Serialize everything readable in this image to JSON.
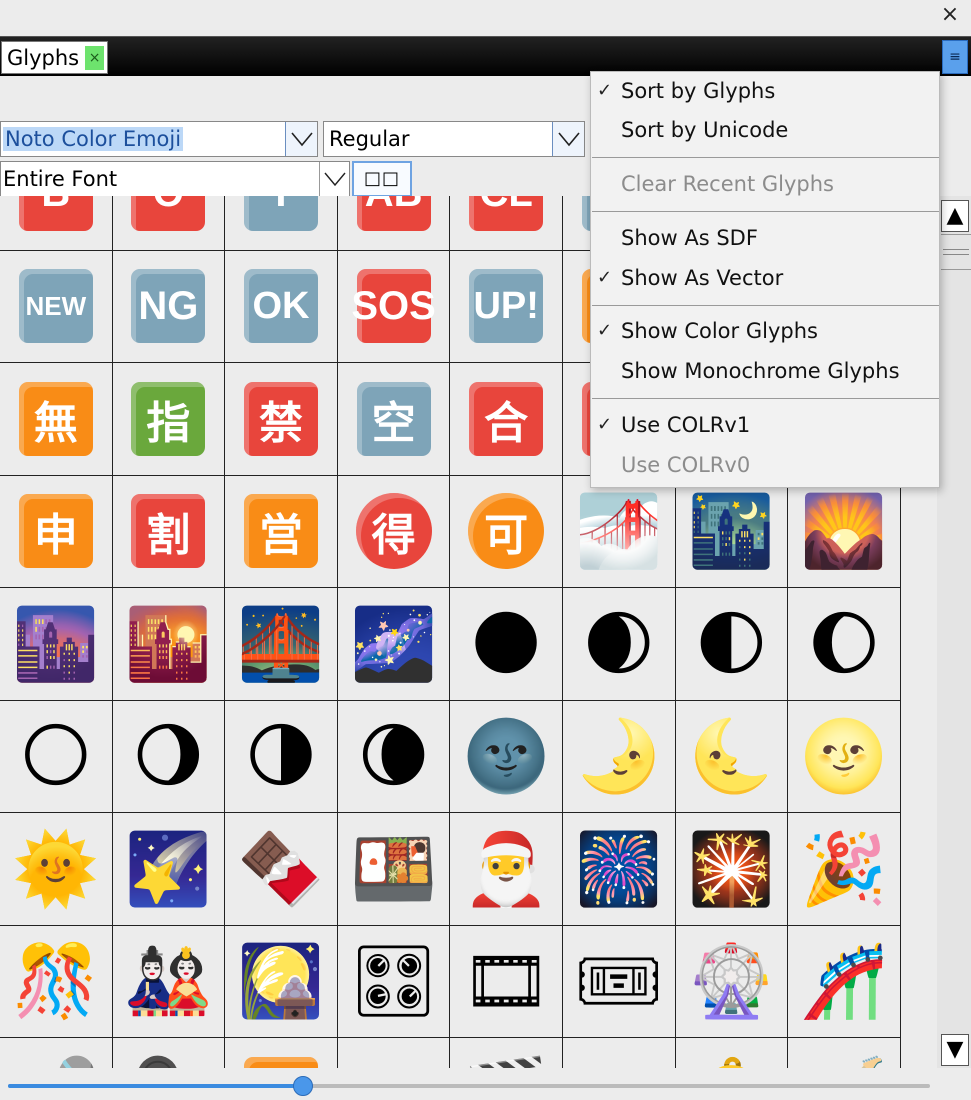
{
  "window": {
    "close_glyph": "×"
  },
  "tabs": [
    {
      "label": "Glyphs",
      "close_glyph": "×"
    }
  ],
  "menu_button_glyph": "≡",
  "toolbar": {
    "font": "Noto Color Emoji",
    "style": "Regular",
    "range": "Entire Font",
    "display_toggle": "□□"
  },
  "menu": {
    "items": [
      {
        "label": "Sort by Glyphs",
        "checked": true,
        "enabled": true
      },
      {
        "label": "Sort by Unicode",
        "checked": false,
        "enabled": true
      },
      {
        "label": "Clear Recent Glyphs",
        "checked": false,
        "enabled": false
      },
      {
        "label": "Show As SDF",
        "checked": false,
        "enabled": true
      },
      {
        "label": "Show As Vector",
        "checked": true,
        "enabled": true
      },
      {
        "label": "Show Color Glyphs",
        "checked": true,
        "enabled": true
      },
      {
        "label": "Show Monochrome Glyphs",
        "checked": false,
        "enabled": true
      },
      {
        "label": "Use COLRv1",
        "checked": true,
        "enabled": true
      },
      {
        "label": "Use COLRv0",
        "checked": false,
        "enabled": false
      }
    ],
    "check_glyph": "✓"
  },
  "scrollbar": {
    "up": "▲",
    "down": "▼"
  },
  "zoom_slider": {
    "value": 0.32
  },
  "glyphs": [
    {
      "kind": "key",
      "text": "B",
      "color": "#e8453c"
    },
    {
      "kind": "key",
      "text": "O",
      "color": "#e8453c"
    },
    {
      "kind": "key",
      "text": "I",
      "color": "#7ea4b8"
    },
    {
      "kind": "key",
      "text": "AB",
      "color": "#e8453c"
    },
    {
      "kind": "key",
      "text": "CL",
      "color": "#e8453c"
    },
    {
      "kind": "key",
      "text": "",
      "color": "#7ea4b8"
    },
    {
      "kind": "blank"
    },
    {
      "kind": "blank"
    },
    {
      "kind": "key",
      "text": "NEW",
      "color": "#7ea4b8",
      "size": "sm"
    },
    {
      "kind": "key",
      "text": "NG",
      "color": "#7ea4b8"
    },
    {
      "kind": "key",
      "text": "OK",
      "color": "#7ea4b8",
      "size": "md"
    },
    {
      "kind": "key",
      "text": "SOS",
      "color": "#e8453c"
    },
    {
      "kind": "key",
      "text": "UP!",
      "color": "#7ea4b8",
      "size": "md"
    },
    {
      "kind": "key",
      "text": "",
      "color": "#f98c16"
    },
    {
      "kind": "blank"
    },
    {
      "kind": "blank"
    },
    {
      "kind": "key",
      "text": "無",
      "color": "#f98c16",
      "size": "cjk"
    },
    {
      "kind": "key",
      "text": "指",
      "color": "#6aa83c",
      "size": "cjk"
    },
    {
      "kind": "key",
      "text": "禁",
      "color": "#e8453c",
      "size": "cjk"
    },
    {
      "kind": "key",
      "text": "空",
      "color": "#7ea4b8",
      "size": "cjk"
    },
    {
      "kind": "key",
      "text": "合",
      "color": "#e8453c",
      "size": "cjk"
    },
    {
      "kind": "key",
      "text": "",
      "color": "#e8453c"
    },
    {
      "kind": "blank"
    },
    {
      "kind": "blank"
    },
    {
      "kind": "key",
      "text": "申",
      "color": "#f98c16",
      "size": "cjk"
    },
    {
      "kind": "key",
      "text": "割",
      "color": "#e8453c",
      "size": "cjk"
    },
    {
      "kind": "key",
      "text": "営",
      "color": "#f98c16",
      "size": "cjk"
    },
    {
      "kind": "circle",
      "text": "得",
      "color": "#e8453c"
    },
    {
      "kind": "circle",
      "text": "可",
      "color": "#f98c16"
    },
    {
      "kind": "emoji",
      "text": "🌁"
    },
    {
      "kind": "emoji",
      "text": "🌃"
    },
    {
      "kind": "emoji",
      "text": "🌄"
    },
    {
      "kind": "emoji",
      "text": "🌆"
    },
    {
      "kind": "emoji",
      "text": "🌇"
    },
    {
      "kind": "emoji",
      "text": "🌉"
    },
    {
      "kind": "emoji",
      "text": "🌌"
    },
    {
      "kind": "emoji",
      "text": "🌑"
    },
    {
      "kind": "emoji",
      "text": "🌒"
    },
    {
      "kind": "emoji",
      "text": "🌓"
    },
    {
      "kind": "emoji",
      "text": "🌔"
    },
    {
      "kind": "emoji",
      "text": "🌕"
    },
    {
      "kind": "emoji",
      "text": "🌖"
    },
    {
      "kind": "emoji",
      "text": "🌗"
    },
    {
      "kind": "emoji",
      "text": "🌘"
    },
    {
      "kind": "emoji",
      "text": "🌚"
    },
    {
      "kind": "emoji",
      "text": "🌛"
    },
    {
      "kind": "emoji",
      "text": "🌜"
    },
    {
      "kind": "emoji",
      "text": "🌝"
    },
    {
      "kind": "emoji",
      "text": "🌞"
    },
    {
      "kind": "emoji",
      "text": "🌠"
    },
    {
      "kind": "emoji",
      "text": "🍫"
    },
    {
      "kind": "emoji",
      "text": "🍱"
    },
    {
      "kind": "emoji",
      "text": "🎅"
    },
    {
      "kind": "emoji",
      "text": "🎆"
    },
    {
      "kind": "emoji",
      "text": "🎇"
    },
    {
      "kind": "emoji",
      "text": "🎉"
    },
    {
      "kind": "emoji",
      "text": "🎊"
    },
    {
      "kind": "emoji",
      "text": "🎎"
    },
    {
      "kind": "emoji",
      "text": "🎑"
    },
    {
      "kind": "emoji",
      "text": "🎛"
    },
    {
      "kind": "emoji",
      "text": "🎞"
    },
    {
      "kind": "emoji",
      "text": "🎟"
    },
    {
      "kind": "emoji",
      "text": "🎡"
    },
    {
      "kind": "emoji",
      "text": "🎢"
    },
    {
      "kind": "emoji",
      "text": "🎤"
    },
    {
      "kind": "emoji",
      "text": "🎥"
    },
    {
      "kind": "key",
      "text": "",
      "color": "#f98c16"
    },
    {
      "kind": "blank"
    },
    {
      "kind": "emoji",
      "text": "🎬"
    },
    {
      "kind": "blank"
    },
    {
      "kind": "emoji",
      "text": "🔔"
    },
    {
      "kind": "emoji",
      "text": "🎸"
    }
  ]
}
